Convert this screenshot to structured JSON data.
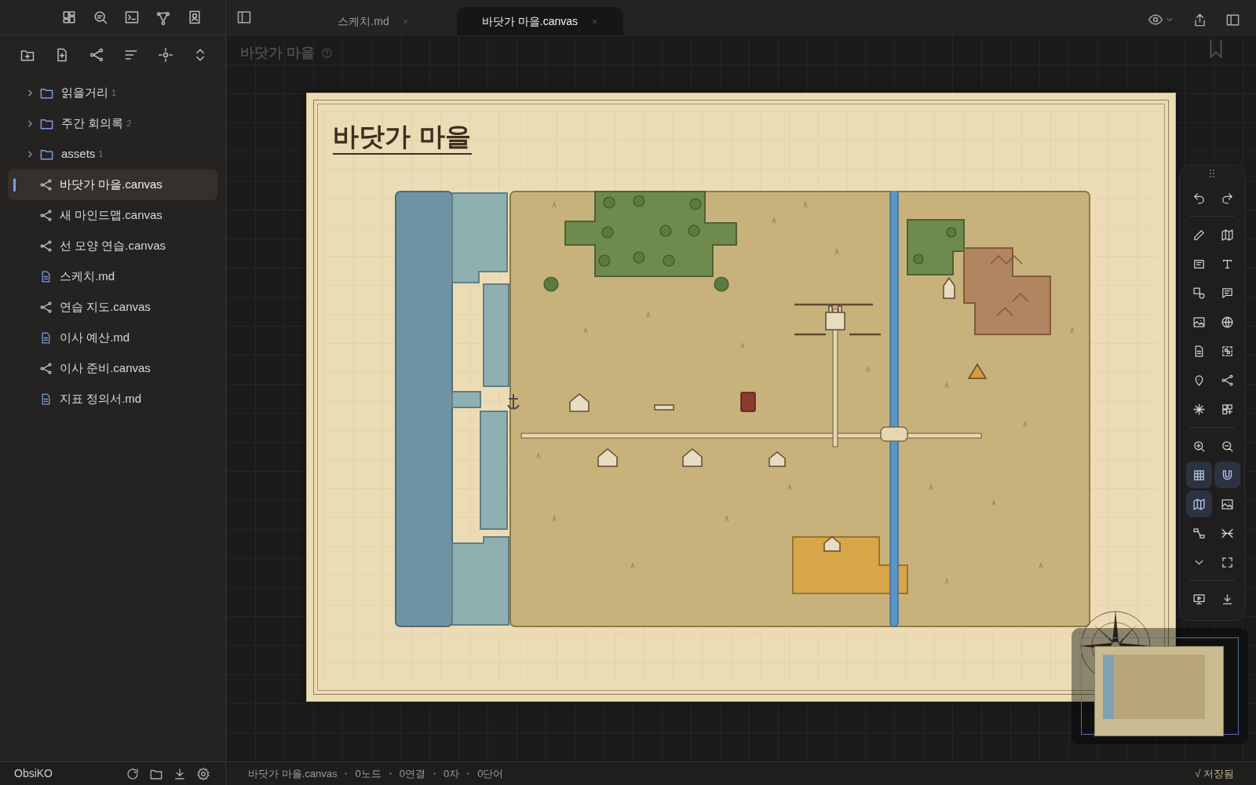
{
  "tabs": [
    {
      "label": "스케치.md",
      "selected": false
    },
    {
      "label": "바닷가 마을.canvas",
      "selected": true
    }
  ],
  "sidebar": {
    "items": [
      {
        "kind": "folder",
        "name": "읽을거리",
        "count": "1",
        "expanded": false
      },
      {
        "kind": "folder",
        "name": "주간 회의록",
        "count": "2",
        "expanded": false
      },
      {
        "kind": "folder",
        "name": "assets",
        "count": "1",
        "expanded": false
      },
      {
        "kind": "canvas",
        "name": "바닷가 마을.canvas",
        "selected": true
      },
      {
        "kind": "canvas",
        "name": "새 마인드맵.canvas",
        "selected": false
      },
      {
        "kind": "canvas",
        "name": "선 모양 연습.canvas",
        "selected": false
      },
      {
        "kind": "note",
        "name": "스케치.md",
        "selected": false
      },
      {
        "kind": "canvas",
        "name": "연습 지도.canvas",
        "selected": false
      },
      {
        "kind": "note",
        "name": "이사 예산.md",
        "selected": false
      },
      {
        "kind": "canvas",
        "name": "이사 준비.canvas",
        "selected": false
      },
      {
        "kind": "note",
        "name": "지표 정의서.md",
        "selected": false
      }
    ]
  },
  "canvas": {
    "title": "바닷가 마을",
    "node_title": "바닷가 마을"
  },
  "toolbar": {
    "groups": [
      [
        {
          "kind": "undo",
          "on": false
        },
        {
          "kind": "redo",
          "on": false
        }
      ],
      [
        {
          "kind": "pencil",
          "on": false
        },
        {
          "kind": "map",
          "on": false
        },
        {
          "kind": "card",
          "on": false
        },
        {
          "kind": "text",
          "on": false
        },
        {
          "kind": "shapes",
          "on": false
        },
        {
          "kind": "note",
          "on": false
        },
        {
          "kind": "image",
          "on": false
        },
        {
          "kind": "globe",
          "on": false
        },
        {
          "kind": "file",
          "on": false
        },
        {
          "kind": "group",
          "on": false
        },
        {
          "kind": "pin",
          "on": false
        },
        {
          "kind": "branch",
          "on": false
        },
        {
          "kind": "sparkle",
          "on": false
        },
        {
          "kind": "widgets",
          "on": false
        }
      ],
      [
        {
          "kind": "zoom-in",
          "on": false
        },
        {
          "kind": "zoom-out",
          "on": false
        },
        {
          "kind": "grid",
          "on": true
        },
        {
          "kind": "magnet",
          "on": true
        },
        {
          "kind": "map",
          "on": true
        },
        {
          "kind": "image",
          "on": false
        },
        {
          "kind": "connect",
          "on": false
        },
        {
          "kind": "collapse",
          "on": false
        },
        {
          "kind": "chevron",
          "on": false
        },
        {
          "kind": "fullscreen",
          "on": false
        }
      ],
      [
        {
          "kind": "present",
          "on": false
        },
        {
          "kind": "download",
          "on": false
        }
      ]
    ]
  },
  "status_bar": {
    "vault": "ObsiKO",
    "items": [
      "바닷가 마을.canvas",
      "0노드",
      "0연결",
      "0자",
      "0단어"
    ],
    "saved": "√ 저장됨"
  }
}
